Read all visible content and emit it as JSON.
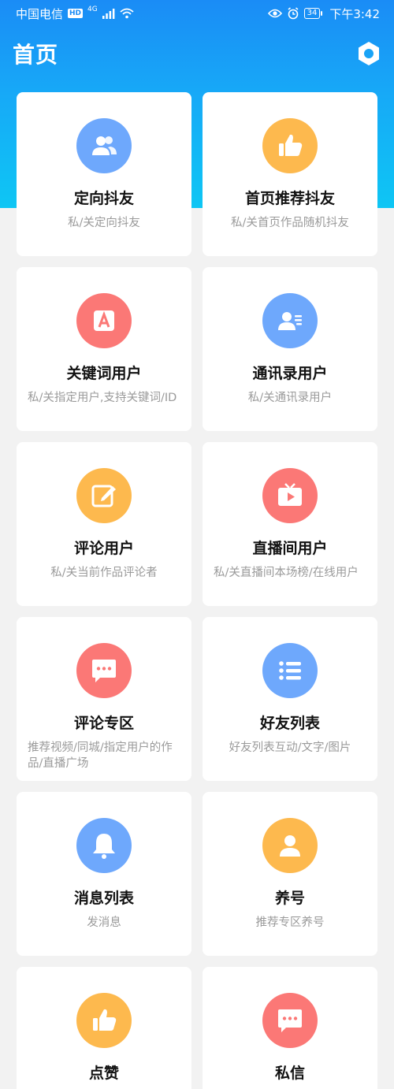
{
  "status_bar": {
    "carrier": "中国电信",
    "hd": "HD",
    "network": "4G",
    "battery": "34",
    "time": "下午3:42"
  },
  "header": {
    "title": "首页"
  },
  "colors": {
    "blue": "#6ea8fc",
    "orange": "#fdb94e",
    "red": "#fb7876",
    "header_gradient_top": "#1a8cf6",
    "header_gradient_bottom": "#0ec6f4"
  },
  "cards": [
    {
      "title": "定向抖友",
      "desc": "私/关定向抖友",
      "icon": "users-icon",
      "color": "blue"
    },
    {
      "title": "首页推荐抖友",
      "desc": "私/关首页作品随机抖友",
      "icon": "thumbs-up-icon",
      "color": "orange"
    },
    {
      "title": "关键词用户",
      "desc": "私/关指定用户,支持关键词/ID",
      "icon": "letter-a-icon",
      "color": "red"
    },
    {
      "title": "通讯录用户",
      "desc": "私/关通讯录用户",
      "icon": "contact-card-icon",
      "color": "blue"
    },
    {
      "title": "评论用户",
      "desc": "私/关当前作品评论者",
      "icon": "edit-icon",
      "color": "orange"
    },
    {
      "title": "直播间用户",
      "desc": "私/关直播间本场榜/在线用户",
      "icon": "tv-play-icon",
      "color": "red"
    },
    {
      "title": "评论专区",
      "desc": "推荐视频/同城/指定用户的作品/直播广场",
      "icon": "chat-bubble-icon",
      "color": "red"
    },
    {
      "title": "好友列表",
      "desc": "好友列表互动/文字/图片",
      "icon": "list-icon",
      "color": "blue"
    },
    {
      "title": "消息列表",
      "desc": "发消息",
      "icon": "bell-icon",
      "color": "blue"
    },
    {
      "title": "养号",
      "desc": "推荐专区养号",
      "icon": "user-icon",
      "color": "orange"
    },
    {
      "title": "点赞",
      "desc": "",
      "icon": "thumbs-up-icon",
      "color": "orange"
    },
    {
      "title": "私信",
      "desc": "",
      "icon": "chat-bubble-icon",
      "color": "red"
    }
  ]
}
